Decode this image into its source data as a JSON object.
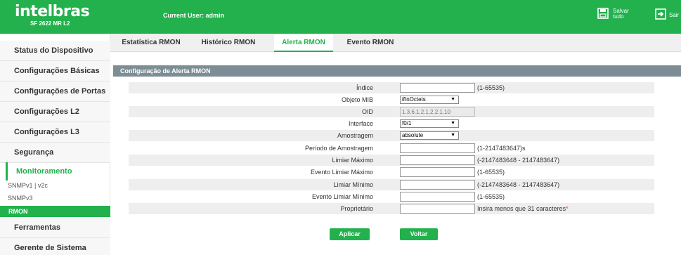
{
  "header": {
    "logo": "intelbras",
    "model": "SF 2622 MR L2",
    "current_user": "Current User: admin",
    "save_label_1": "Salvar",
    "save_label_2": "tudo",
    "exit_label": "Sair"
  },
  "sidebar": {
    "items": [
      {
        "label": "Status do Dispositivo"
      },
      {
        "label": "Configurações Básicas"
      },
      {
        "label": "Configurações de Portas"
      },
      {
        "label": "Configurações L2"
      },
      {
        "label": "Configurações L3"
      },
      {
        "label": "Segurança"
      },
      {
        "label": "Monitoramento"
      },
      {
        "label": "Ferramentas"
      },
      {
        "label": "Gerente de Sistema"
      }
    ],
    "subitems": [
      {
        "label": "SNMPv1 | v2c"
      },
      {
        "label": "SNMPv3"
      },
      {
        "label": "RMON"
      }
    ]
  },
  "tabs": [
    {
      "label": "Estatística RMON"
    },
    {
      "label": "Histórico RMON"
    },
    {
      "label": "Alerta RMON"
    },
    {
      "label": "Evento RMON"
    }
  ],
  "section_title": "Configuração de Alerta RMON",
  "form": {
    "rows": [
      {
        "label": "Índice",
        "value": "",
        "hint": "(1-65535)"
      },
      {
        "label": "Objeto MIB",
        "value": "ifInOctets",
        "hint": ""
      },
      {
        "label": "OID",
        "value": "1.3.6.1.2.1.2.2.1.10",
        "hint": ""
      },
      {
        "label": "Interface",
        "value": "f0/1",
        "hint": ""
      },
      {
        "label": "Amostragem",
        "value": "absolute",
        "hint": ""
      },
      {
        "label": "Período de Amostragem",
        "value": "",
        "hint": "(1-2147483647)s"
      },
      {
        "label": "Limiar Máximo",
        "value": "",
        "hint": "(-2147483648 - 2147483647)"
      },
      {
        "label": "Evento Limiar Máximo",
        "value": "",
        "hint": "(1-65535)"
      },
      {
        "label": "Limiar Mínimo",
        "value": "",
        "hint": "(-2147483648 - 2147483647)"
      },
      {
        "label": "Evento Limiar Mínimo",
        "value": "",
        "hint": "(1-65535)"
      },
      {
        "label": "Proprietário",
        "value": "",
        "hint": "Insira menos que 31 caracteres",
        "required_mark": "*"
      }
    ]
  },
  "buttons": {
    "apply": "Aplicar",
    "back": "Voltar"
  },
  "colors": {
    "brand": "#22b14c",
    "section_bar": "#7d8d95"
  }
}
